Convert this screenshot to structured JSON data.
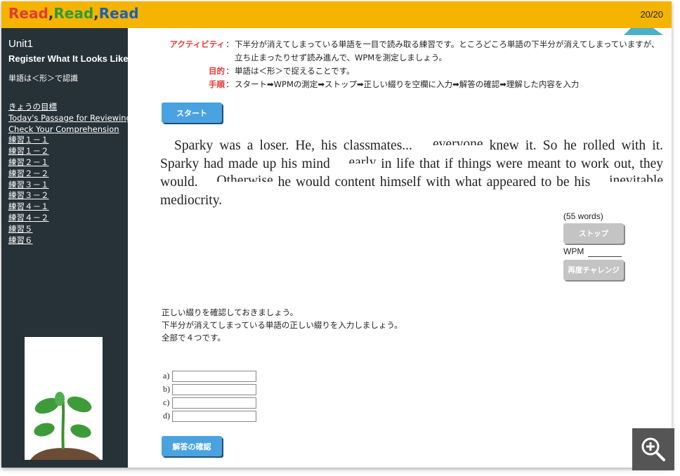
{
  "app": {
    "logo": {
      "w1": "Read",
      "c1": ",",
      "w2": "Read",
      "c2": ",",
      "w3": "Read"
    },
    "page_counter": "20/20"
  },
  "sidebar": {
    "unit_number": "Unit1",
    "unit_title": "Register What It Looks Like",
    "unit_subtitle": "単語は＜形＞で認識",
    "nav_items": [
      "きょうの目標",
      "Today's Passage for Reviewing",
      "Check Your Comprehension",
      "練習１－１",
      "練習１－２",
      "練習２－１",
      "練習２－２",
      "練習３－１",
      "練習３－２",
      "練習４－１",
      "練習４－２",
      "練習５",
      "練習６"
    ]
  },
  "instructions": {
    "activity_label": "アクティビティ",
    "activity_text": "下半分が消えてしまっている単語を一目で読み取る練習です。ところどころ単語の下半分が消えてしまっていますが、立ち止まったりせず読み進んで、WPMを測定しましょう。",
    "purpose_label": "目的",
    "purpose_text": "単語は＜形＞で捉えることです。",
    "steps_label": "手順",
    "steps_text": "スタート➡WPMの測定➡ストップ➡正しい綴りを空欄に入力➡解答の確認➡理解した内容を入力",
    "colon": "："
  },
  "buttons": {
    "start": "スタート",
    "stop": "ストップ",
    "retry": "再度チャレンジ",
    "check_answers": "解答の確認"
  },
  "passage": {
    "p1": "Sparky was a loser. He, his classmates... ",
    "c1": "everyone",
    "p2": " knew it. So he rolled with it. Sparky had made up his mind ",
    "c2": "early",
    "p3": " in life that if things were meant to work out, they would. ",
    "c3": "Otherwise",
    "p4": " he would content himself with what appeared to be his ",
    "c4": "inevitable",
    "p5": " mediocrity."
  },
  "timer": {
    "word_count": "(55 words)",
    "wpm_label": "WPM"
  },
  "notes": {
    "line1": "正しい綴りを確認しておきましょう。",
    "line2": "下半分が消えてしまっている単語の正しい綴りを入力しましょう。",
    "line3": "全部で４つです。"
  },
  "answers": [
    {
      "label": "a)",
      "value": ""
    },
    {
      "label": "b)",
      "value": ""
    },
    {
      "label": "c)",
      "value": ""
    },
    {
      "label": "d)",
      "value": ""
    }
  ],
  "colors": {
    "topbar": "#f4b400",
    "sidebar": "#263238",
    "accent_red": "#e53935",
    "button_blue": "#4aa3e0",
    "button_gray": "#c4c4c4"
  },
  "icons": {
    "zoom": "zoom-in-icon",
    "plant": "plant-illustration"
  }
}
